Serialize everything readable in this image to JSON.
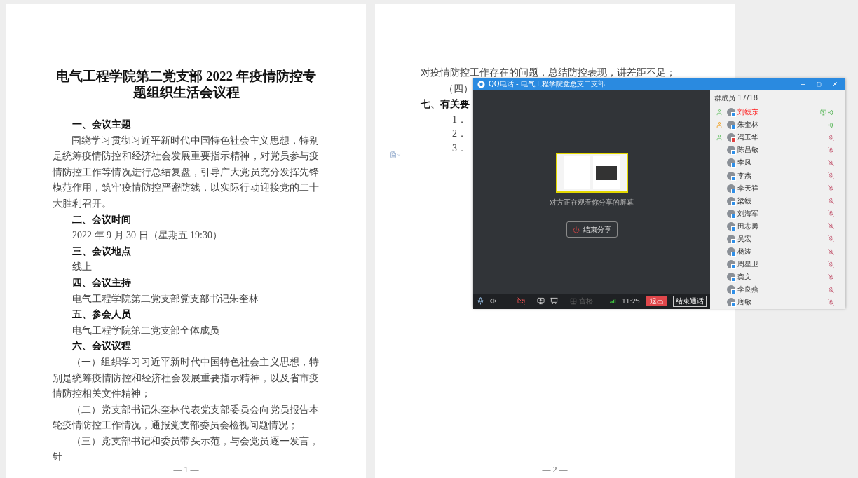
{
  "pages": [
    {
      "blocks": [
        {
          "kind": "title",
          "text": "电气工程学院第二党支部 2022 年疫情防控专题组织生活会议程"
        },
        {
          "kind": "heading",
          "text": "一、会议主题"
        },
        {
          "kind": "paragraph",
          "text": "围绕学习贯彻习近平新时代中国特色社会主义思想，特别是统筹疫情防控和经济社会发展重要指示精神，对党员参与疫情防控工作等情况进行总结复盘，引导广大党员充分发挥先锋模范作用，筑牢疫情防控严密防线，以实际行动迎接党的二十大胜利召开。"
        },
        {
          "kind": "heading",
          "text": "二、会议时间"
        },
        {
          "kind": "line",
          "text": "2022 年 9 月 30 日（星期五  19:30）"
        },
        {
          "kind": "heading",
          "text": "三、会议地点"
        },
        {
          "kind": "line",
          "text": "线上"
        },
        {
          "kind": "heading",
          "text": "四、会议主持"
        },
        {
          "kind": "line",
          "text": "电气工程学院第二党支部党支部书记朱奎林"
        },
        {
          "kind": "heading",
          "text": "五、参会人员"
        },
        {
          "kind": "line",
          "text": "电气工程学院第二党支部全体成员"
        },
        {
          "kind": "heading",
          "text": "六、会议议程"
        },
        {
          "kind": "paragraph",
          "text": "（一）组织学习习近平新时代中国特色社会主义思想，特别是统筹疫情防控和经济社会发展重要指示精神，以及省市疫情防控相关文件精神；"
        },
        {
          "kind": "paragraph",
          "text": "（二）党支部书记朱奎林代表党支部委员会向党员报告本轮疫情防控工作情况，通报党支部委员会检视问题情况；"
        },
        {
          "kind": "paragraph",
          "text": "（三）党支部书记和委员带头示范，与会党员逐一发言，针"
        }
      ],
      "page_number": "— 1 —"
    },
    {
      "blocks": [
        {
          "kind": "plain",
          "text": "对疫情防控工作存在的问题，总结防控表现，讲差距不足；"
        },
        {
          "kind": "indent",
          "text": "（四）"
        },
        {
          "kind": "plain-heading",
          "text": "七、有关要"
        },
        {
          "kind": "item",
          "text": "1．"
        },
        {
          "kind": "item",
          "text": "2．"
        },
        {
          "kind": "item",
          "text": "3．"
        }
      ],
      "page_number": "— 2 —"
    }
  ],
  "call_window": {
    "title": "QQ电话 - 电气工程学院党总支二支部",
    "sharing_notice": "对方正在观看你分享的屏幕",
    "stop_share_button": "结束分享",
    "toolbar": {
      "grid_label": "宫格",
      "time": "11:25",
      "exit_button": "退出",
      "end_call_button": "结束通话"
    },
    "members_header": "群成员 17/18",
    "members": [
      {
        "name": "刘毅东",
        "manager": true,
        "owner": false,
        "highlighted": true,
        "sharing": true,
        "speaking": true,
        "muted": false
      },
      {
        "name": "朱奎林",
        "manager": false,
        "owner": true,
        "highlighted": false,
        "sharing": false,
        "speaking": true,
        "muted": false
      },
      {
        "name": "冯玉华",
        "manager": true,
        "owner": false,
        "highlighted": false,
        "sharing": false,
        "speaking": false,
        "muted": true
      },
      {
        "name": "陈昌敏",
        "manager": false,
        "owner": false,
        "highlighted": false,
        "sharing": false,
        "speaking": false,
        "muted": true
      },
      {
        "name": "李凤",
        "manager": false,
        "owner": false,
        "highlighted": false,
        "sharing": false,
        "speaking": false,
        "muted": true
      },
      {
        "name": "李杰",
        "manager": false,
        "owner": false,
        "highlighted": false,
        "sharing": false,
        "speaking": false,
        "muted": true
      },
      {
        "name": "李天祥",
        "manager": false,
        "owner": false,
        "highlighted": false,
        "sharing": false,
        "speaking": false,
        "muted": true
      },
      {
        "name": "梁毅",
        "manager": false,
        "owner": false,
        "highlighted": false,
        "sharing": false,
        "speaking": false,
        "muted": true
      },
      {
        "name": "刘海军",
        "manager": false,
        "owner": false,
        "highlighted": false,
        "sharing": false,
        "speaking": false,
        "muted": true
      },
      {
        "name": "田志勇",
        "manager": false,
        "owner": false,
        "highlighted": false,
        "sharing": false,
        "speaking": false,
        "muted": true
      },
      {
        "name": "吴宏",
        "manager": false,
        "owner": false,
        "highlighted": false,
        "sharing": false,
        "speaking": false,
        "muted": true
      },
      {
        "name": "杨涛",
        "manager": false,
        "owner": false,
        "highlighted": false,
        "sharing": false,
        "speaking": false,
        "muted": true
      },
      {
        "name": "周星卫",
        "manager": false,
        "owner": false,
        "highlighted": false,
        "sharing": false,
        "speaking": false,
        "muted": true
      },
      {
        "name": "龚文",
        "manager": false,
        "owner": false,
        "highlighted": false,
        "sharing": false,
        "speaking": false,
        "muted": true
      },
      {
        "name": "李良燕",
        "manager": false,
        "owner": false,
        "highlighted": false,
        "sharing": false,
        "speaking": false,
        "muted": true
      },
      {
        "name": "唐敏",
        "manager": false,
        "owner": false,
        "highlighted": false,
        "sharing": false,
        "speaking": false,
        "muted": true
      }
    ]
  }
}
